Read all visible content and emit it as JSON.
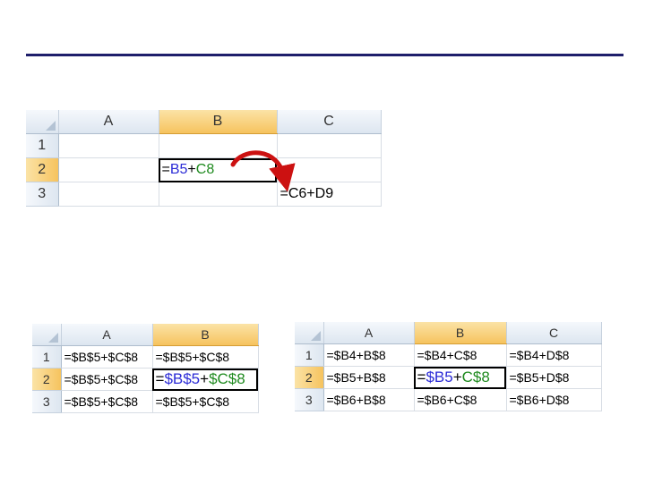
{
  "top_sheet": {
    "columns": [
      "A",
      "B",
      "C"
    ],
    "rows": [
      "1",
      "2",
      "3"
    ],
    "b2": {
      "eq": "=",
      "ref1": "B5",
      "plus": "+",
      "ref2": "C8"
    },
    "c3": "=C6+D9"
  },
  "bottom_left_sheet": {
    "columns": [
      "A",
      "B"
    ],
    "rows": [
      "1",
      "2",
      "3"
    ],
    "cells": [
      [
        "=$B$5+$C$8",
        "=$B$5+$C$8"
      ],
      [
        "=$B$5+$C$8",
        "=$B$5+$C$8"
      ],
      [
        "=$B$5+$C$8",
        "=$B$5+$C$8"
      ]
    ],
    "active": {
      "eq": "=",
      "ref1": "$B$5",
      "plus": "+",
      "ref2": "$C$8"
    }
  },
  "bottom_right_sheet": {
    "columns": [
      "A",
      "B",
      "C"
    ],
    "rows": [
      "1",
      "2",
      "3"
    ],
    "cells": [
      [
        "=$B4+B$8",
        "=$B4+C$8",
        "=$B4+D$8"
      ],
      [
        "=$B5+B$8",
        "=$B5+C$8",
        "=$B5+D$8"
      ],
      [
        "=$B6+B$8",
        "=$B6+C$8",
        "=$B6+D$8"
      ]
    ],
    "active": {
      "eq": "=",
      "ref1": "$B5",
      "plus": "+",
      "ref2": "C$8"
    }
  },
  "colors": {
    "title_rule": "#1f1f6b",
    "selected_header": "#f6c35e",
    "ref_blue": "#2b2bd6",
    "ref_green": "#1e8a1e",
    "arrow": "#cc1111"
  }
}
